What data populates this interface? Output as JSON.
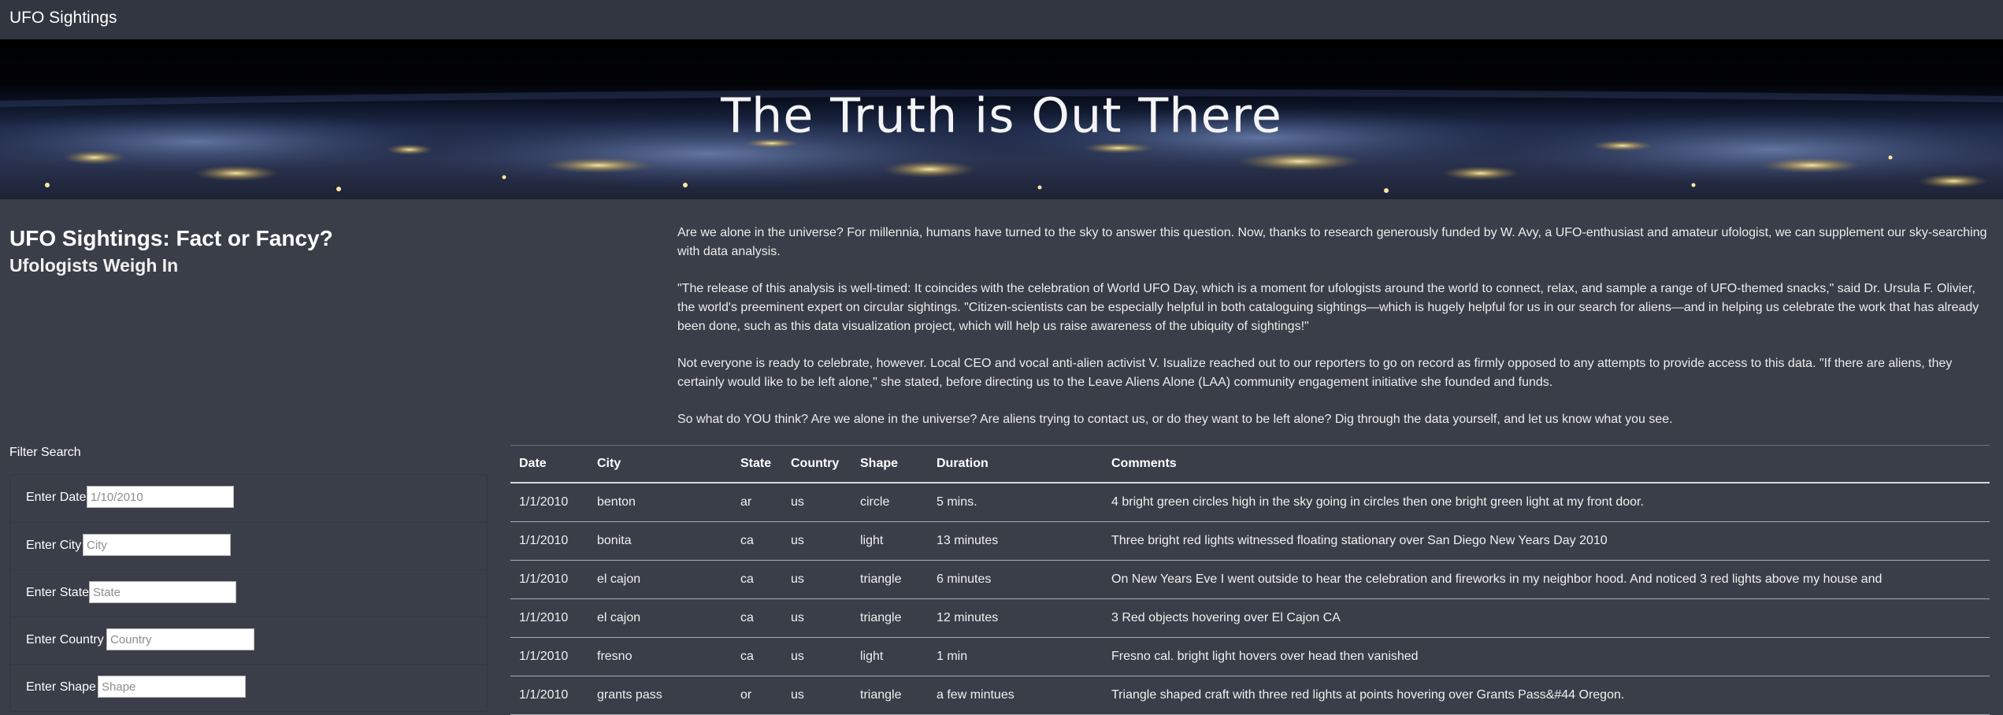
{
  "navbar": {
    "brand": "UFO Sightings"
  },
  "hero": {
    "title": "The Truth is Out There"
  },
  "heading": {
    "title": "UFO Sightings: Fact or Fancy?",
    "subtitle": "Ufologists Weigh In"
  },
  "article": {
    "paragraphs": [
      "Are we alone in the universe? For millennia, humans have turned to the sky to answer this question. Now, thanks to research generously funded by W. Avy, a UFO-enthusiast and amateur ufologist, we can supplement our sky-searching with data analysis.",
      "\"The release of this analysis is well-timed: It coincides with the celebration of World UFO Day, which is a moment for ufologists around the world to connect, relax, and sample a range of UFO-themed snacks,\" said Dr. Ursula F. Olivier, the world's preeminent expert on circular sightings. \"Citizen-scientists can be especially helpful in both cataloguing sightings—which is hugely helpful for us in our search for aliens—and in helping us celebrate the work that has already been done, such as this data visualization project, which will help us raise awareness of the ubiquity of sightings!\"",
      "Not everyone is ready to celebrate, however. Local CEO and vocal anti-alien activist V. Isualize reached out to our reporters to go on record as firmly opposed to any attempts to provide access to this data. \"If there are aliens, they certainly would like to be left alone,\" she stated, before directing us to the Leave Aliens Alone (LAA) community engagement initiative she founded and funds.",
      "So what do YOU think? Are we alone in the universe? Are aliens trying to contact us, or do they want to be left alone? Dig through the data yourself, and let us know what you see."
    ]
  },
  "filters": {
    "title": "Filter Search",
    "fields": [
      {
        "label": "Enter Date",
        "placeholder": "1/10/2010",
        "value": ""
      },
      {
        "label": "Enter City",
        "placeholder": "City",
        "value": ""
      },
      {
        "label": "Enter State",
        "placeholder": "State",
        "value": ""
      },
      {
        "label": "Enter Country",
        "placeholder": "Country",
        "value": ""
      },
      {
        "label": "Enter Shape",
        "placeholder": "Shape",
        "value": ""
      }
    ]
  },
  "table": {
    "headers": [
      "Date",
      "City",
      "State",
      "Country",
      "Shape",
      "Duration",
      "Comments"
    ],
    "rows": [
      [
        "1/1/2010",
        "benton",
        "ar",
        "us",
        "circle",
        "5 mins.",
        "4 bright green circles high in the sky going in circles then one bright green light at my front door."
      ],
      [
        "1/1/2010",
        "bonita",
        "ca",
        "us",
        "light",
        "13 minutes",
        "Three bright red lights witnessed floating stationary over San Diego New Years Day 2010"
      ],
      [
        "1/1/2010",
        "el cajon",
        "ca",
        "us",
        "triangle",
        "6 minutes",
        "On New Years Eve I went outside to hear the celebration and fireworks in my neighbor hood. And noticed 3 red lights above my house and"
      ],
      [
        "1/1/2010",
        "el cajon",
        "ca",
        "us",
        "triangle",
        "12 minutes",
        "3 Red objects hovering over El Cajon CA"
      ],
      [
        "1/1/2010",
        "fresno",
        "ca",
        "us",
        "light",
        "1 min",
        "Fresno cal. bright light hovers over head then vanished"
      ],
      [
        "1/1/2010",
        "grants pass",
        "or",
        "us",
        "triangle",
        "a few mintues",
        "Triangle shaped craft with three red lights at points hovering over Grants Pass&#44 Oregon."
      ]
    ]
  }
}
